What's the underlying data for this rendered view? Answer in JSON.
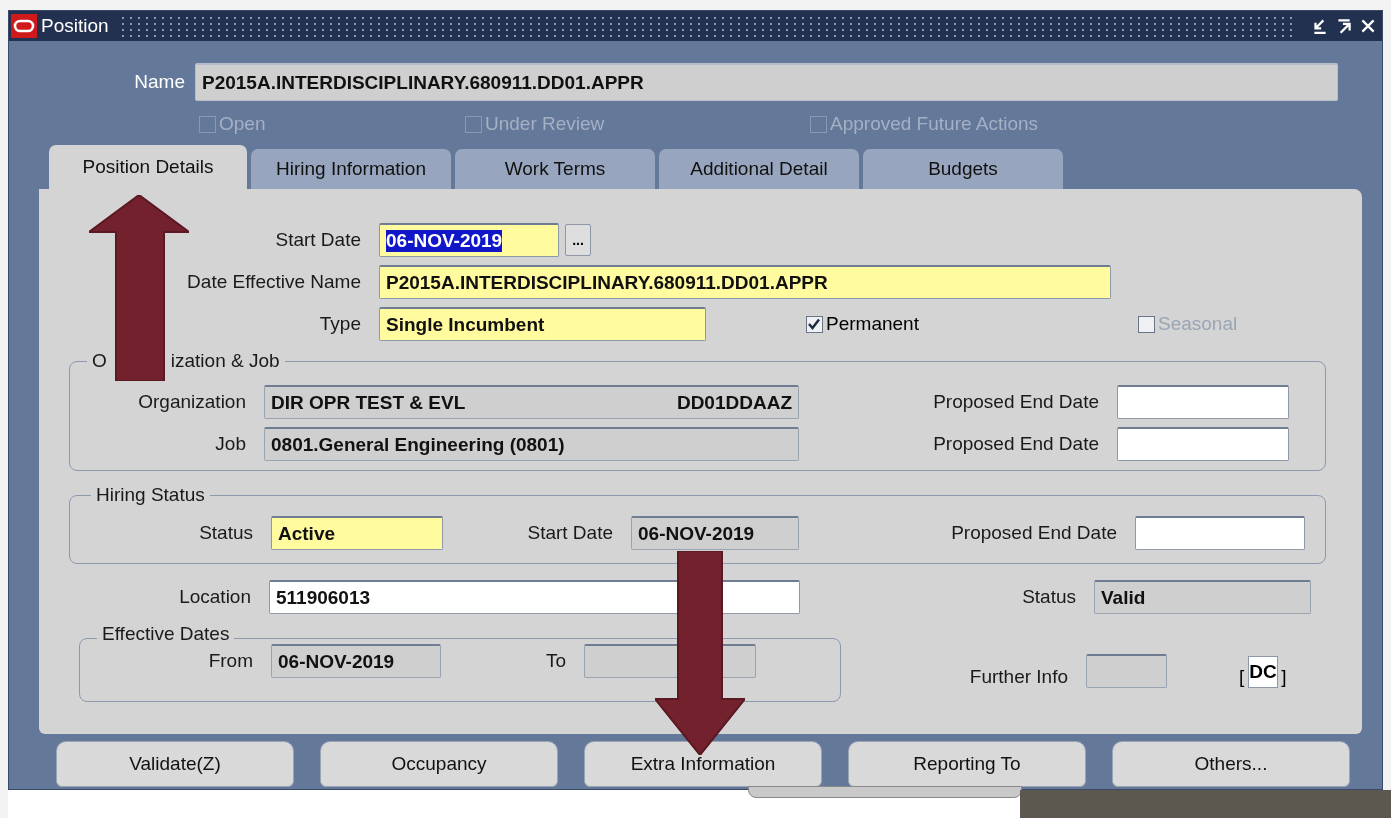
{
  "window": {
    "title": "Position"
  },
  "name": {
    "label": "Name",
    "value": "P2015A.INTERDISCIPLINARY.680911.DD01.APPR",
    "kind": "readonly"
  },
  "flags": [
    {
      "label": "Open",
      "checked": false,
      "disabled": true
    },
    {
      "label": "Under Review",
      "checked": false,
      "disabled": true
    },
    {
      "label": "Approved Future Actions",
      "checked": false,
      "disabled": true
    }
  ],
  "tabs": [
    {
      "label": "Position Details",
      "selected": true
    },
    {
      "label": "Hiring Information",
      "selected": false
    },
    {
      "label": "Work Terms",
      "selected": false
    },
    {
      "label": "Additional Detail",
      "selected": false
    },
    {
      "label": "Budgets",
      "selected": false
    }
  ],
  "details": {
    "start_date": {
      "label": "Start Date",
      "value": "06-NOV-2019",
      "kind": "required",
      "highlighted": true,
      "button": "..."
    },
    "date_effective_name": {
      "label": "Date Effective Name",
      "value": "P2015A.INTERDISCIPLINARY.680911.DD01.APPR",
      "kind": "required"
    },
    "type": {
      "label": "Type",
      "value": "Single Incumbent",
      "kind": "required"
    },
    "permanent": {
      "label": "Permanent",
      "checked": true,
      "disabled": false
    },
    "seasonal": {
      "label": "Seasonal",
      "checked": false,
      "disabled": true
    },
    "organization_job": {
      "title_parts": [
        "O",
        "ization & Job"
      ],
      "organization": {
        "label": "Organization",
        "value": "DIR OPR TEST & EVL",
        "code": "DD01DDAAZ",
        "kind": "readonly"
      },
      "job": {
        "label": "Job",
        "value": "0801.General Engineering (0801)",
        "kind": "readonly"
      },
      "proposed_end_dates": [
        {
          "label": "Proposed End Date",
          "kind": "editable"
        },
        {
          "label": "Proposed End Date",
          "kind": "editable"
        }
      ]
    },
    "hiring_status": {
      "title": "Hiring Status",
      "status": {
        "label": "Status",
        "value": "Active",
        "kind": "required"
      },
      "start_date": {
        "label": "Start Date",
        "value": "06-NOV-2019",
        "kind": "readonly"
      },
      "proposed_end_date": {
        "label": "Proposed End Date",
        "kind": "editable"
      }
    },
    "location": {
      "label": "Location",
      "value": "511906013",
      "kind": "editable"
    },
    "status": {
      "label": "Status",
      "value": "Valid",
      "kind": "readonly"
    },
    "effective_dates": {
      "title": "Effective Dates",
      "from": {
        "label": "From",
        "value": "06-NOV-2019",
        "kind": "readonly"
      },
      "to": {
        "label": "To",
        "kind": "readonly"
      }
    },
    "further_info": {
      "label": "Further Info",
      "kind": "readonly",
      "open_bracket": "[",
      "context": "DC",
      "close_bracket": "]"
    }
  },
  "buttons": [
    "Validate(Z)",
    "Occupancy",
    "Extra Information",
    "Reporting To",
    "Others..."
  ]
}
